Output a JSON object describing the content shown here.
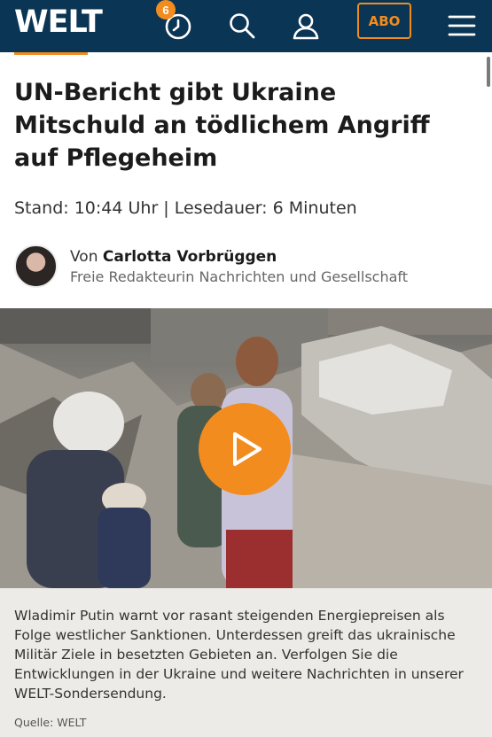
{
  "header": {
    "logo": "WELT",
    "notification_count": "6",
    "abo_label": "ABO",
    "icons": [
      "clock-icon",
      "search-icon",
      "user-icon",
      "menu-icon"
    ]
  },
  "article": {
    "headline": "UN-Bericht gibt Ukraine Mitschuld an tödlichem Angriff auf Pflegeheim",
    "meta": "Stand: 10:44 Uhr | Lesedauer: 6 Minuten",
    "author_prefix": "Von ",
    "author_name": "Carlotta Vorbrüggen",
    "author_role": "Freie Redakteurin Nachrichten und Gesellschaft"
  },
  "video": {
    "caption": "Wladimir Putin warnt vor rasant steigenden Energiepreisen als Folge westlicher Sanktionen. Unterdessen greift das ukrainische Militär Ziele in besetzten Gebieten an. Verfolgen Sie die Entwicklungen in der Ukraine und weitere Nachrichten in unserer WELT-Sondersendung.",
    "source": "Quelle: WELT"
  },
  "colors": {
    "brand_navy": "#0a3554",
    "accent_orange": "#f28c1e"
  }
}
